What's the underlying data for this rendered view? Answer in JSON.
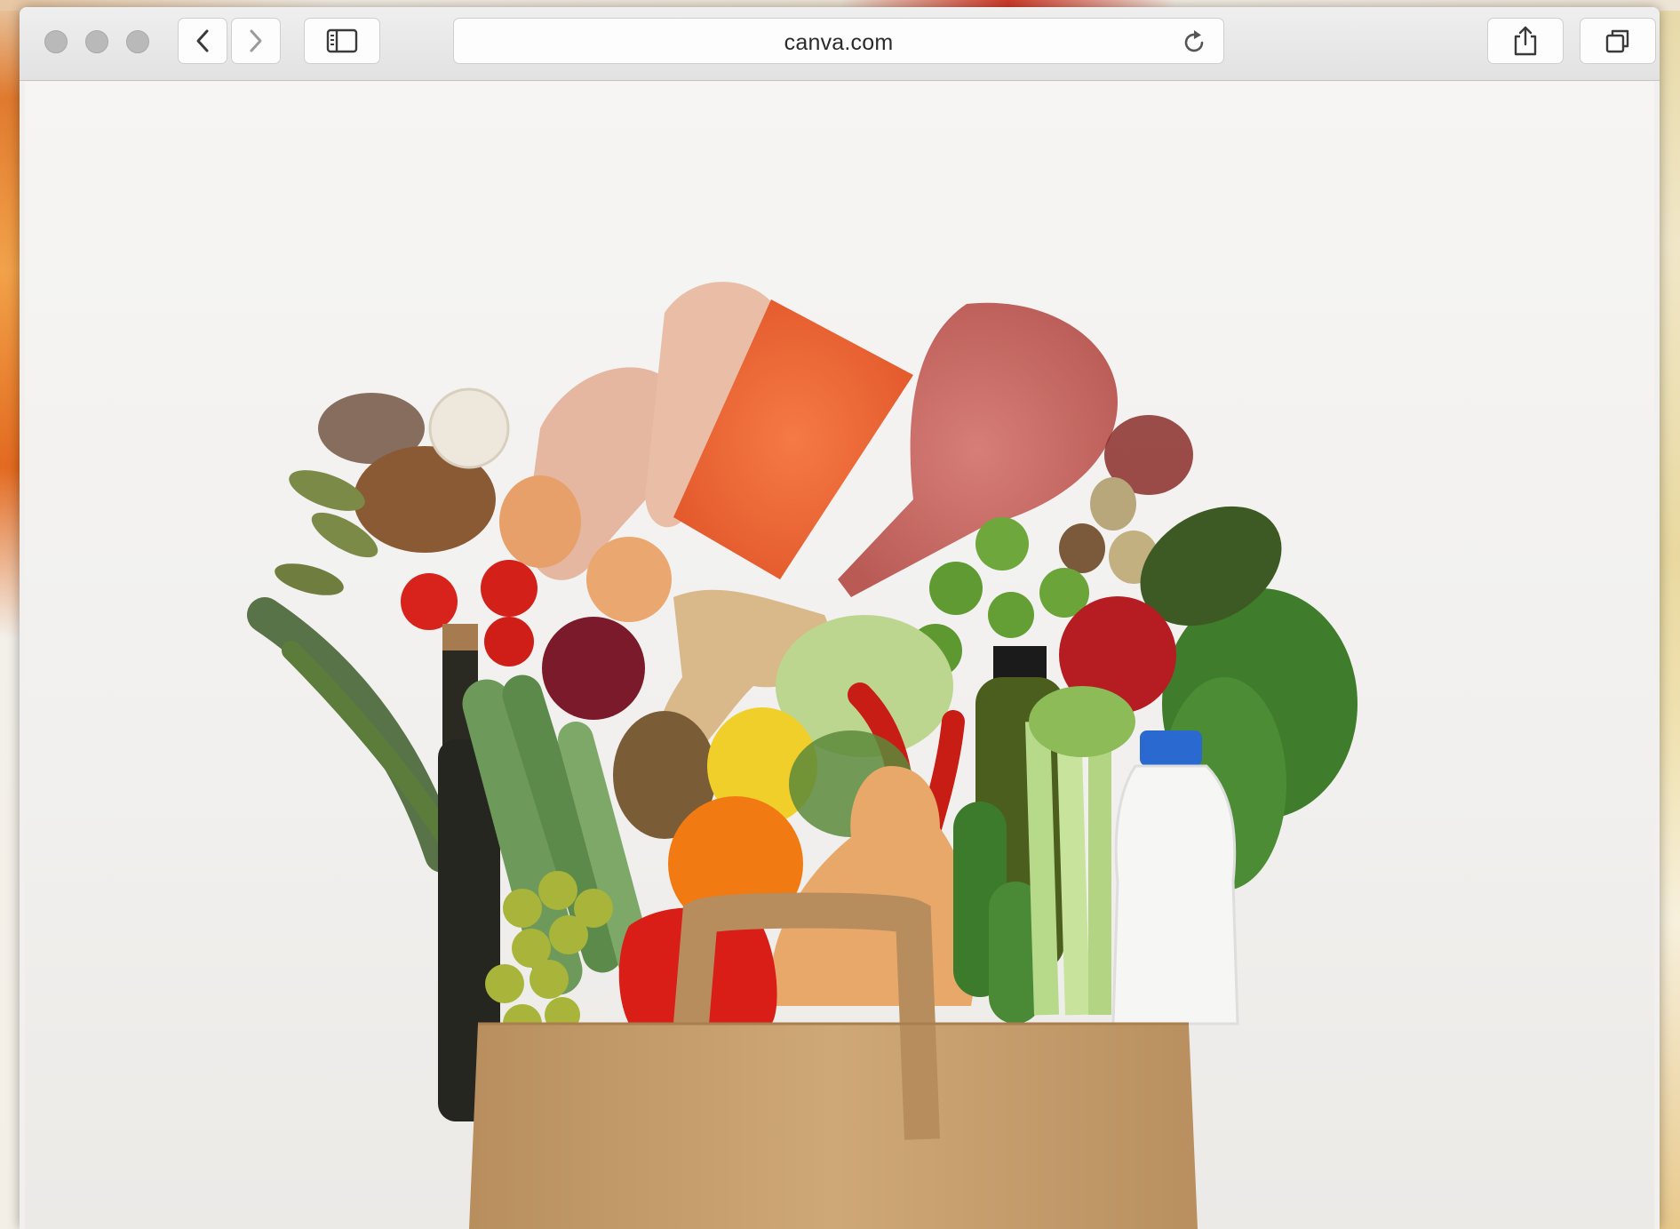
{
  "browser": {
    "address_bar": {
      "url": "canva.com"
    },
    "icons": {
      "back": "chevron-left-icon",
      "forward": "chevron-right-icon",
      "sidebar": "sidebar-icon",
      "reload": "reload-icon",
      "share": "share-icon",
      "tabs": "tabs-icon"
    }
  },
  "content": {
    "image_subject": "grocery-bag-photo"
  },
  "colors": {
    "toolbar": "#e6e6e6",
    "page": "#f3f2f0",
    "bag": "#c9a57a"
  }
}
